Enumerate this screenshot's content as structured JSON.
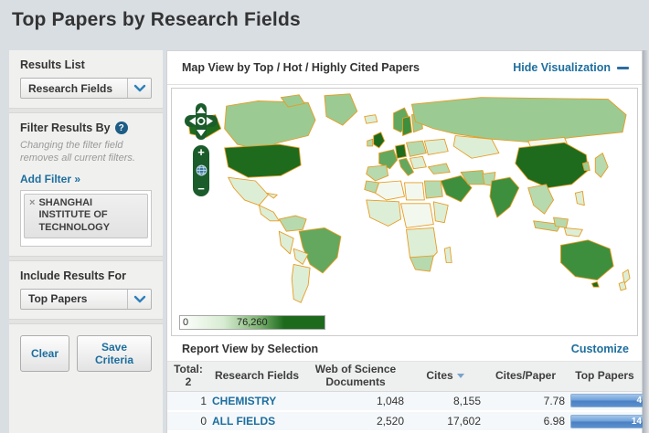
{
  "page": {
    "title": "Top Papers by Research Fields"
  },
  "sidebar": {
    "results_list": {
      "label": "Results List",
      "selected": "Research Fields"
    },
    "filter": {
      "label": "Filter Results By",
      "help_icon": "?",
      "note": "Changing the filter field removes all current filters.",
      "add_filter_label": "Add Filter »",
      "tags": [
        {
          "remove_icon": "×",
          "label": "SHANGHAI INSTITUTE OF TECHNOLOGY"
        }
      ]
    },
    "include_results": {
      "label": "Include Results For",
      "selected": "Top Papers"
    },
    "buttons": {
      "clear": "Clear",
      "save": "Save Criteria"
    }
  },
  "map_section": {
    "title": "Map View by Top / Hot / Highly Cited Papers",
    "hide_link": "Hide Visualization",
    "controls": {
      "zoom_in": "+",
      "zoom_out": "−",
      "icons": [
        "pan-arrows-icon",
        "globe-icon"
      ]
    },
    "legend": {
      "min": "0",
      "max": "76,260"
    },
    "colors": {
      "scale_low": "#ffffff",
      "scale_high": "#1d6a1d",
      "country_border": "#e89b20",
      "control_green": "#1b5c2b"
    }
  },
  "report": {
    "title": "Report View by Selection",
    "customize_link": "Customize",
    "table": {
      "total_label": "Total:",
      "total_value": "2",
      "columns": [
        "Research Fields",
        "Web of Science Documents",
        "Cites",
        "Cites/Paper",
        "Top Papers"
      ],
      "sorted_column": "Cites",
      "rows": [
        {
          "num": "1",
          "field": "CHEMISTRY",
          "documents": "1,048",
          "cites": "8,155",
          "cites_per_paper": "7.78",
          "top_papers": "4"
        },
        {
          "num": "0",
          "field": "ALL FIELDS",
          "documents": "2,520",
          "cites": "17,602",
          "cites_per_paper": "6.98",
          "top_papers": "14"
        }
      ]
    }
  },
  "colors": {
    "link_blue": "#1c6e9e",
    "bar_blue": "#5b90cd",
    "header_bg": "#d9dee3"
  }
}
